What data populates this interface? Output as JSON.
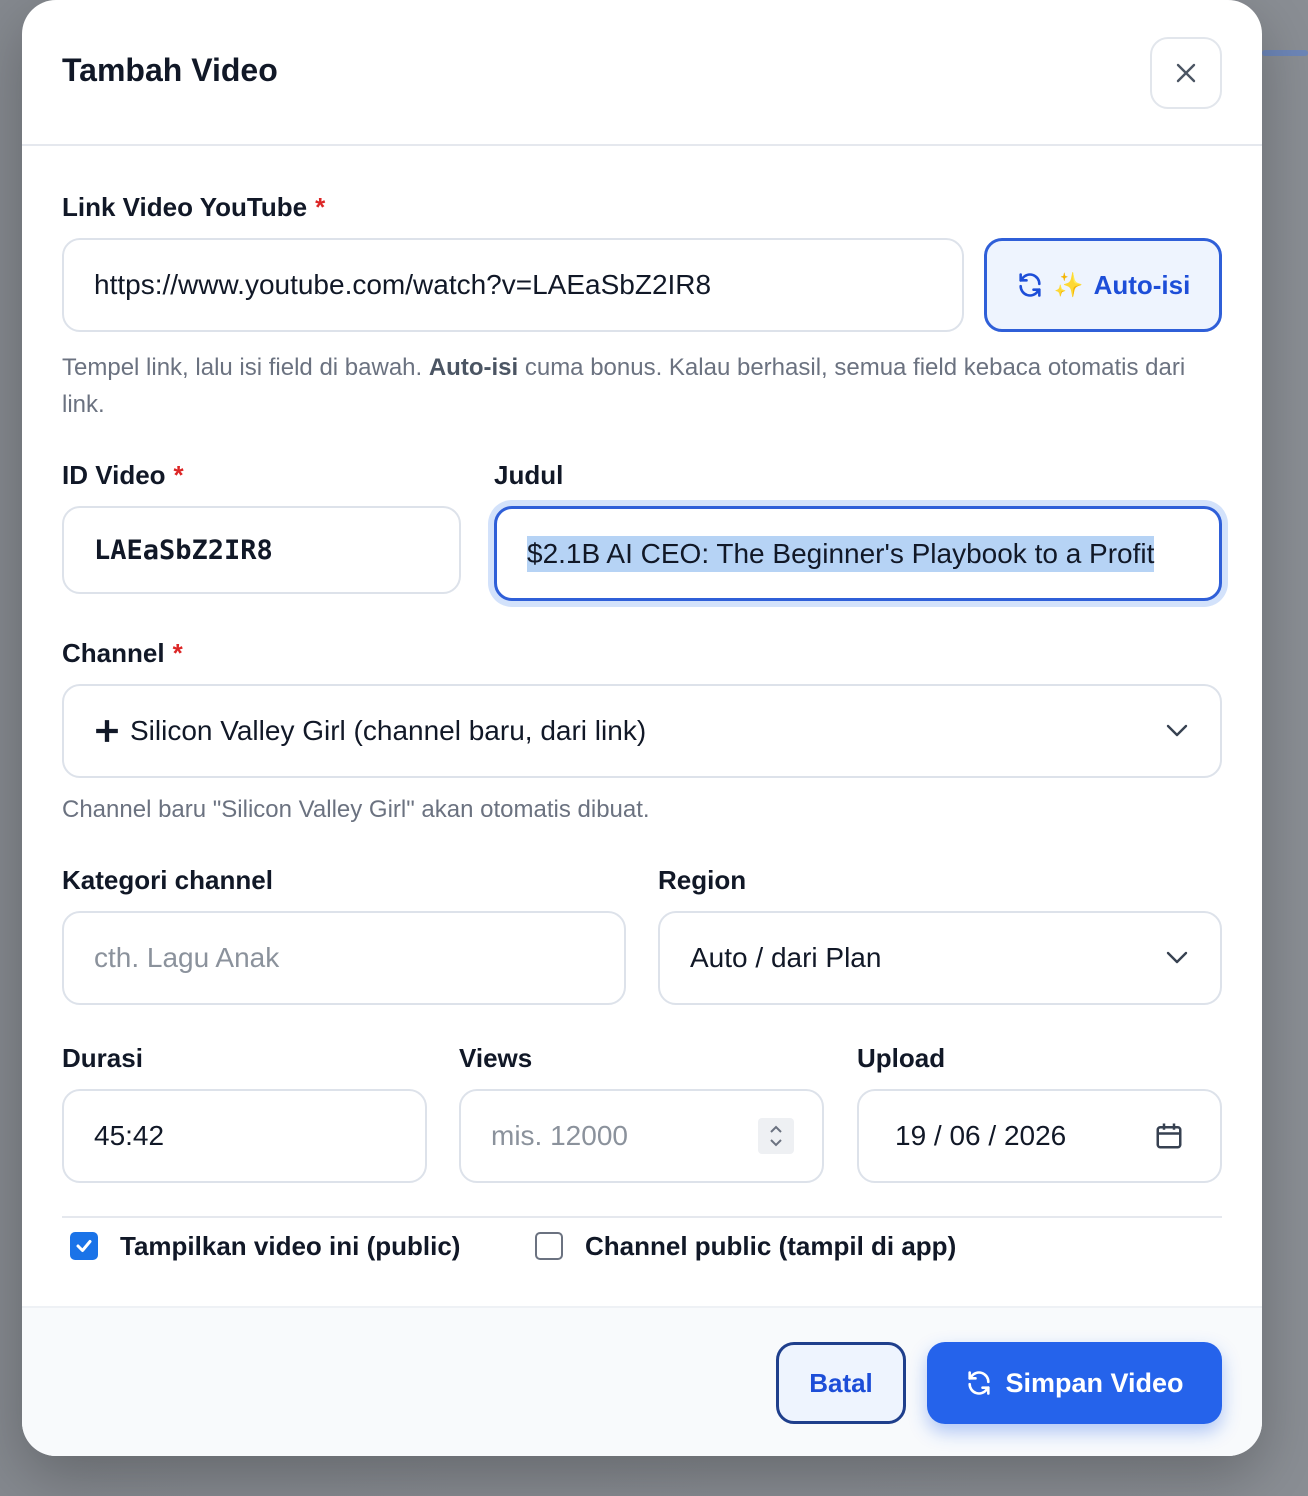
{
  "modal": {
    "title": "Tambah Video",
    "close_icon": "close-icon"
  },
  "link": {
    "label": "Link Video YouTube",
    "required_mark": "*",
    "value": "https://www.youtube.com/watch?v=LAEaSbZ2IR8",
    "autofill_label": "Auto-isi",
    "autofill_icons": [
      "refresh-icon",
      "sparkles-icon"
    ],
    "help_before": "Tempel link, lalu isi field di bawah. ",
    "help_bold": "Auto-isi",
    "help_after": " cuma bonus. Kalau berhasil, semua field kebaca otomatis dari link."
  },
  "video_id": {
    "label": "ID Video",
    "required_mark": "*",
    "value": "LAEaSbZ2IR8"
  },
  "title_field": {
    "label": "Judul",
    "value": "$2.1B AI CEO: The Beginner's Playbook to a Profit"
  },
  "channel": {
    "label": "Channel",
    "required_mark": "*",
    "selected": "Silicon Valley Girl (channel baru, dari link)",
    "selected_prefix": "+",
    "help": "Channel baru \"Silicon Valley Girl\" akan otomatis dibuat."
  },
  "category": {
    "label": "Kategori channel",
    "placeholder": "cth. Lagu Anak"
  },
  "region": {
    "label": "Region",
    "selected": "Auto / dari Plan"
  },
  "duration": {
    "label": "Durasi",
    "value": "45:42"
  },
  "views": {
    "label": "Views",
    "placeholder": "mis. 12000"
  },
  "upload": {
    "label": "Upload",
    "value": "19 / 06 / 2026"
  },
  "checkboxes": [
    {
      "label": "Tampilkan video ini (public)",
      "checked": true
    },
    {
      "label": "Channel public (tampil di app)",
      "checked": false
    }
  ],
  "footer": {
    "cancel_label": "Batal",
    "save_label": "Simpan Video"
  },
  "colors": {
    "primary": "#2563eb",
    "required": "#dc2626",
    "focus_ring": "#d3e2fb"
  }
}
